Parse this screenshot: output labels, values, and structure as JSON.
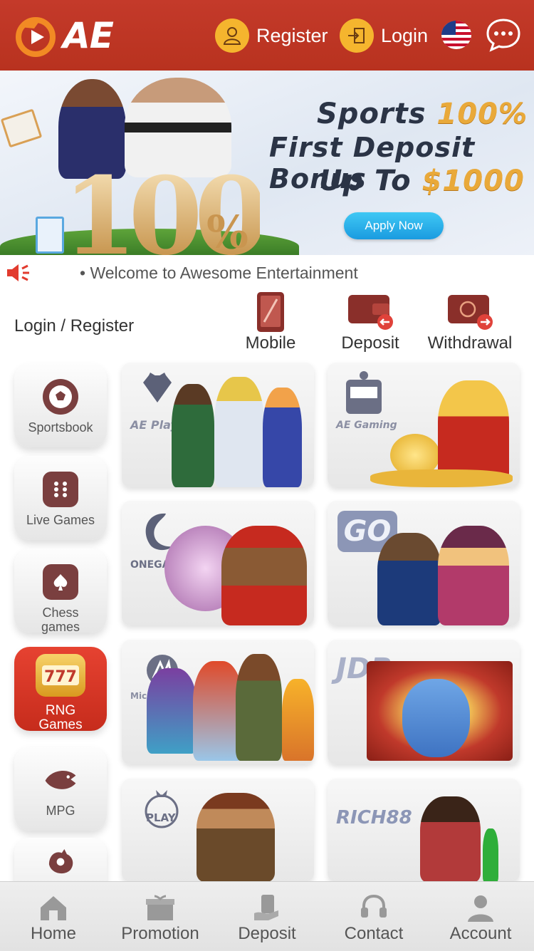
{
  "header": {
    "logo_text": "AE",
    "register_label": "Register",
    "login_label": "Login"
  },
  "banner": {
    "line1_a": "Sports",
    "line1_b": "100%",
    "line2": "First Deposit Bonus",
    "line3_a": "Up To",
    "line3_b": "$1000",
    "big_number": "100",
    "big_pct": "%",
    "apply_label": "Apply Now"
  },
  "marquee": {
    "text": "• Welcome to Awesome Entertainment"
  },
  "quick": {
    "login_register": "Login / Register",
    "items": [
      {
        "label": "Mobile"
      },
      {
        "label": "Deposit"
      },
      {
        "label": "Withdrawal"
      }
    ]
  },
  "categories": [
    {
      "label": "Sportsbook",
      "icon": "soccer-ball-icon"
    },
    {
      "label": "Live Games",
      "icon": "dice-icon"
    },
    {
      "label": "Chess games",
      "icon": "spade-card-icon"
    },
    {
      "label": "RNG Games",
      "icon": "slot-machine-icon",
      "active": true
    },
    {
      "label": "MPG",
      "icon": "fish-icon"
    },
    {
      "label": "",
      "icon": "rooster-icon"
    }
  ],
  "games": [
    {
      "brand": "AE Play"
    },
    {
      "brand": "AE Gaming"
    },
    {
      "brand": "ONEGAME"
    },
    {
      "brand": "GO"
    },
    {
      "brand": "Microgaming"
    },
    {
      "brand": "JDB"
    },
    {
      "brand": "PLAY"
    },
    {
      "brand": "RICH88"
    }
  ],
  "nav": {
    "items": [
      {
        "label": "Home"
      },
      {
        "label": "Promotion"
      },
      {
        "label": "Deposit"
      },
      {
        "label": "Contact"
      },
      {
        "label": "Account"
      }
    ]
  },
  "colors": {
    "header": "#c0392b",
    "accent": "#f5b52e",
    "active_category": "#d93726"
  }
}
